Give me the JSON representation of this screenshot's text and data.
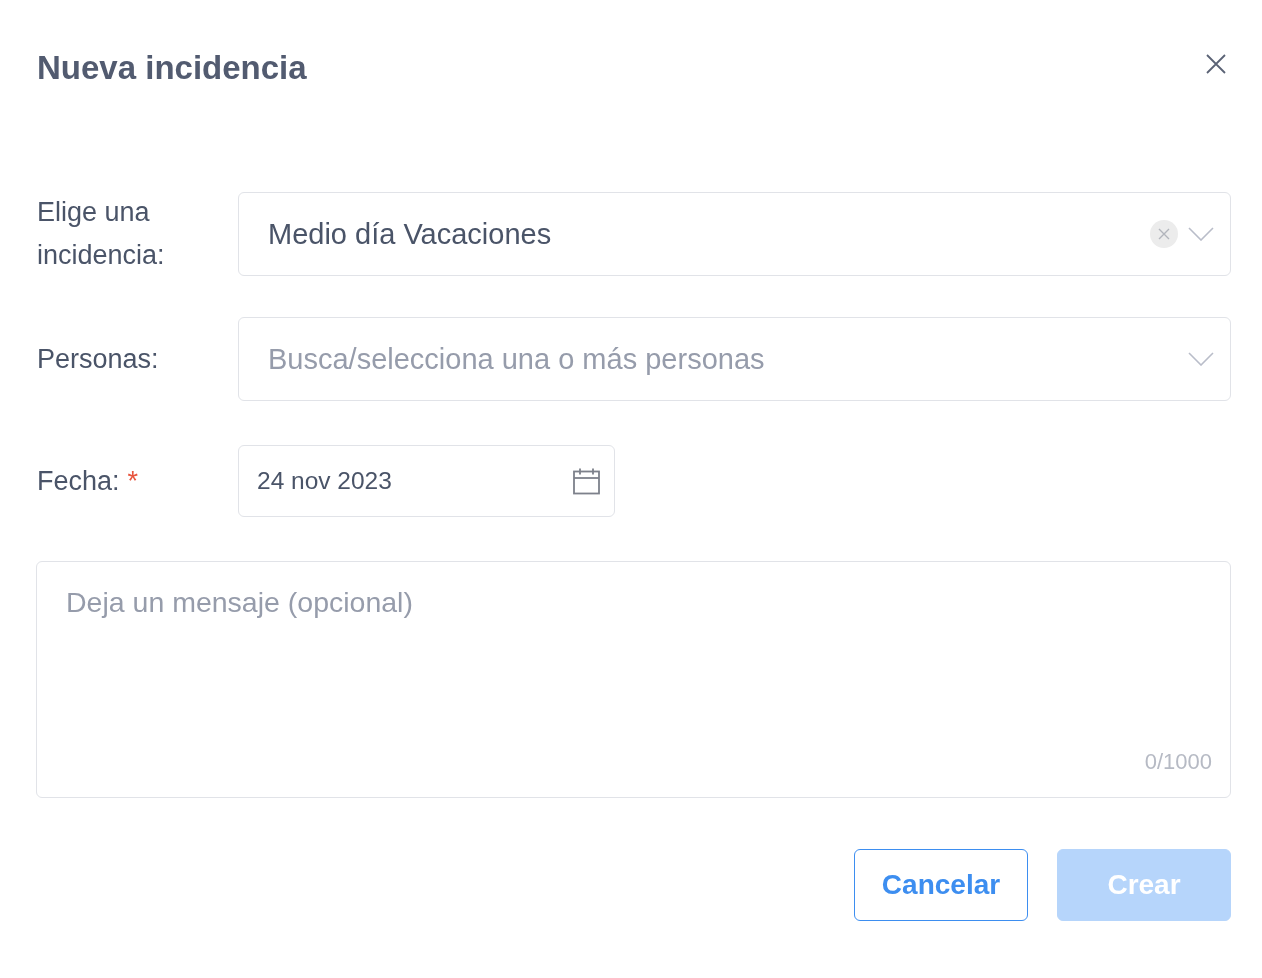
{
  "dialog": {
    "title": "Nueva incidencia"
  },
  "fields": [
    {
      "kind": "select",
      "label": "Elige una incidencia:",
      "value": "Medio día Vacaciones",
      "clearable": true
    },
    {
      "kind": "select",
      "label": "Personas:",
      "placeholder": "Busca/selecciona una o más personas",
      "clearable": false
    },
    {
      "kind": "date",
      "label": "Fecha:",
      "value": "24 nov 2023",
      "required_mark": "*",
      "clearable": false
    }
  ],
  "message": {
    "placeholder": "Deja un mensaje (opcional)",
    "counter": "0/1000"
  },
  "buttons": [
    {
      "label": "Cancelar",
      "kind": "secondary",
      "disabled": false
    },
    {
      "label": "Crear",
      "kind": "primary",
      "disabled": true
    }
  ]
}
